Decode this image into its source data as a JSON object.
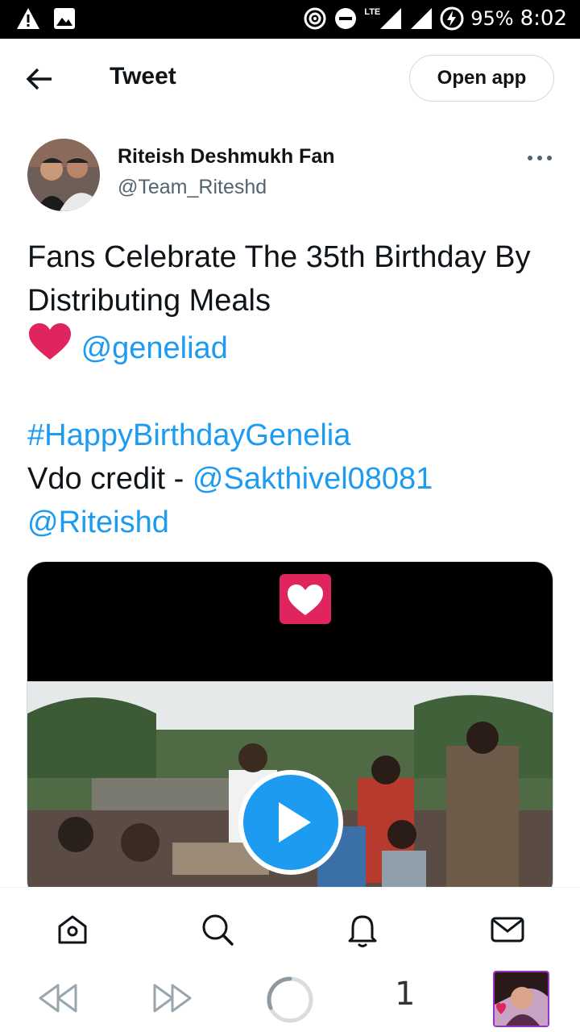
{
  "status_bar": {
    "battery": "95%",
    "time": "8:02",
    "network": "LTE"
  },
  "header": {
    "title": "Tweet",
    "open_app_label": "Open app"
  },
  "tweet": {
    "author_name": "Riteish Deshmukh Fan",
    "author_handle": "@Team_Riteshd",
    "text_line1": "Fans Celebrate The 35th Birthday By Distributing Meals",
    "mention1": "@geneliad",
    "hashtag": "#HappyBirthdayGenelia",
    "credit_prefix": "Vdo credit - ",
    "mention2": "@Sakthivel08081",
    "mention3": "@Riteishd"
  },
  "bottom_nav": {
    "icons": [
      "home-icon",
      "search-icon",
      "notifications-icon",
      "messages-icon"
    ]
  },
  "browser_bar": {
    "tab_count": "1"
  },
  "colors": {
    "link": "#1d9bf0",
    "text": "#0f1419",
    "secondary": "#536471",
    "heart": "#e0245e"
  }
}
